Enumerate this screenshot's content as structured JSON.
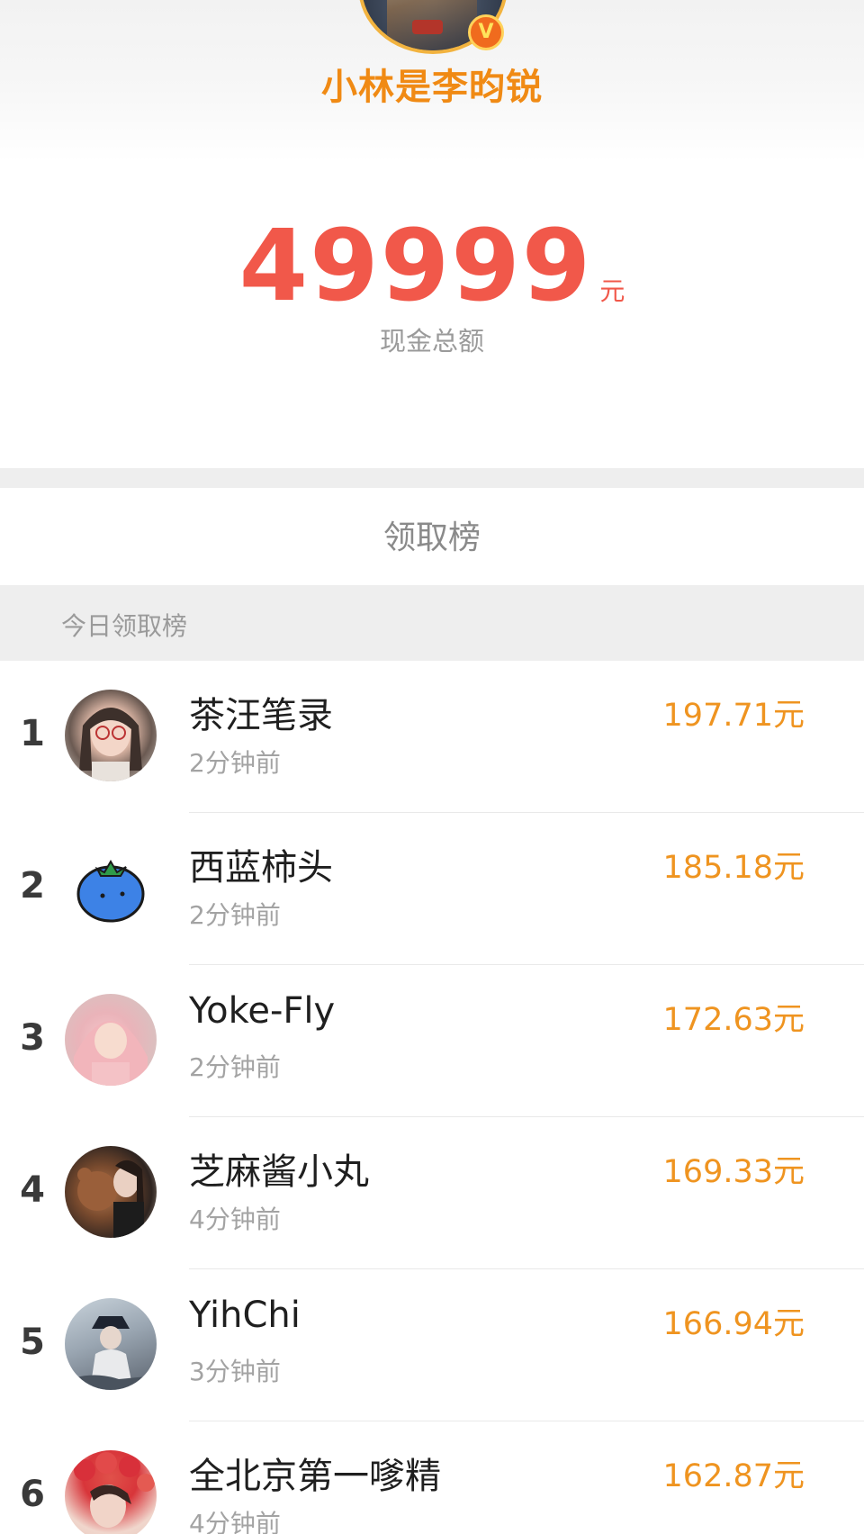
{
  "profile": {
    "username": "小林是李昀锐",
    "verified_badge": "V"
  },
  "summary": {
    "amount": "49999",
    "unit": "元",
    "label": "现金总额"
  },
  "board": {
    "title": "领取榜",
    "section": "今日领取榜"
  },
  "entries": [
    {
      "rank": "1",
      "name": "茶汪笔录",
      "time": "2分钟前",
      "amount": "197.71元",
      "avatar": "avatar-girl-glasses"
    },
    {
      "rank": "2",
      "name": "西蓝柿头",
      "time": "2分钟前",
      "amount": "185.18元",
      "avatar": "avatar-blue-tomato"
    },
    {
      "rank": "3",
      "name": "Yoke-Fly",
      "time": "2分钟前",
      "amount": "172.63元",
      "avatar": "avatar-pink-hood"
    },
    {
      "rank": "4",
      "name": "芝麻酱小丸",
      "time": "4分钟前",
      "amount": "169.33元",
      "avatar": "avatar-teddy-bear"
    },
    {
      "rank": "5",
      "name": "YihChi",
      "time": "3分钟前",
      "amount": "166.94元",
      "avatar": "avatar-hat-person"
    },
    {
      "rank": "6",
      "name": "全北京第一嗲精",
      "time": "4分钟前",
      "amount": "162.87元",
      "avatar": "avatar-flower-crown"
    }
  ],
  "colors": {
    "username": "#f08a14",
    "amount": "#f1584a",
    "money": "#ef9420",
    "band": "#eeeeee"
  }
}
